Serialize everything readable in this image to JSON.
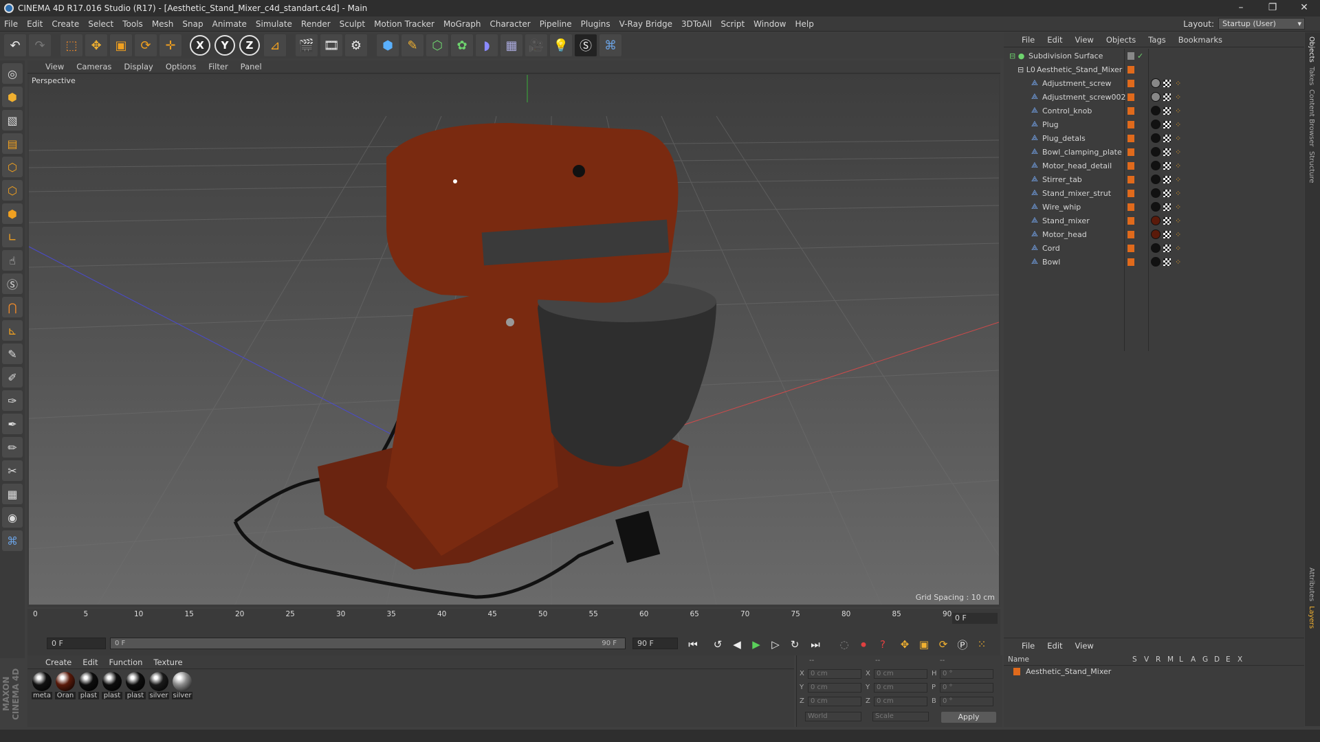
{
  "window": {
    "title": "CINEMA 4D R17.016 Studio (R17) - [Aesthetic_Stand_Mixer_c4d_standart.c4d] - Main",
    "controls": [
      "–",
      "❐",
      "✕"
    ]
  },
  "menu": [
    "File",
    "Edit",
    "Create",
    "Select",
    "Tools",
    "Mesh",
    "Snap",
    "Animate",
    "Simulate",
    "Render",
    "Sculpt",
    "Motion Tracker",
    "MoGraph",
    "Character",
    "Pipeline",
    "Plugins",
    "V-Ray Bridge",
    "3DToAll",
    "Script",
    "Window",
    "Help"
  ],
  "layout": {
    "label": "Layout:",
    "value": "Startup (User)"
  },
  "viewport": {
    "menu": [
      "View",
      "Cameras",
      "Display",
      "Options",
      "Filter",
      "Panel"
    ],
    "camera": "Perspective",
    "grid_spacing": "Grid Spacing : 10 cm"
  },
  "objects_panel": {
    "menu": [
      "File",
      "Edit",
      "View",
      "Objects",
      "Tags",
      "Bookmarks"
    ],
    "root": "Subdivision Surface",
    "group": "Aesthetic_Stand_Mixer",
    "items": [
      "Adjustment_screw",
      "Adjustment_screw002",
      "Control_knob",
      "Plug",
      "Plug_detals",
      "Bowl_clamping_plate",
      "Motor_head_detail",
      "Stirrer_tab",
      "Stand_mixer_strut",
      "Wire_whip",
      "Stand_mixer",
      "Motor_head",
      "Cord",
      "Bowl"
    ]
  },
  "side_tabs": [
    "Objects",
    "Takes",
    "Content Browser",
    "Structure"
  ],
  "side_tabs_lower": [
    "Attributes",
    "Layers"
  ],
  "timeline": {
    "ticks": [
      "0",
      "5",
      "10",
      "15",
      "20",
      "25",
      "30",
      "35",
      "40",
      "45",
      "50",
      "55",
      "60",
      "65",
      "70",
      "75",
      "80",
      "85",
      "90"
    ],
    "current_frame": "0 F"
  },
  "transport": {
    "start": "0 F",
    "slider_start": "0 F",
    "slider_end": "90 F",
    "end": "90 F"
  },
  "materials": {
    "menu": [
      "Create",
      "Edit",
      "Function",
      "Texture"
    ],
    "items": [
      {
        "label": "meta",
        "color": "#111111"
      },
      {
        "label": "Oran",
        "color": "#5a1a0a"
      },
      {
        "label": "plast",
        "color": "#0d0d0d"
      },
      {
        "label": "plast",
        "color": "#0d0d0d"
      },
      {
        "label": "plast",
        "color": "#0d0d0d"
      },
      {
        "label": "silver",
        "color": "#1a1a1a"
      },
      {
        "label": "silver",
        "color": "#8a8a8a"
      }
    ]
  },
  "coords": {
    "header": [
      "--",
      "--",
      "--"
    ],
    "rows": [
      {
        "a": "X",
        "av": "0 cm",
        "b": "X",
        "bv": "0 cm",
        "c": "H",
        "cv": "0 °"
      },
      {
        "a": "Y",
        "av": "0 cm",
        "b": "Y",
        "bv": "0 cm",
        "c": "P",
        "cv": "0 °"
      },
      {
        "a": "Z",
        "av": "0 cm",
        "b": "Z",
        "bv": "0 cm",
        "c": "B",
        "cv": "0 °"
      }
    ],
    "mode": "World",
    "scale": "Scale",
    "apply": "Apply"
  },
  "layers_panel": {
    "menu": [
      "File",
      "Edit",
      "View"
    ],
    "columns": [
      "Name",
      "S",
      "V",
      "R",
      "M",
      "L",
      "A",
      "G",
      "D",
      "E",
      "X"
    ],
    "row": "Aesthetic_Stand_Mixer"
  },
  "brand": "MAXON CINEMA 4D",
  "colors": {
    "mixer": "#7a2a10",
    "layer": "#e06a1c",
    "accent": "#2a6db0"
  }
}
